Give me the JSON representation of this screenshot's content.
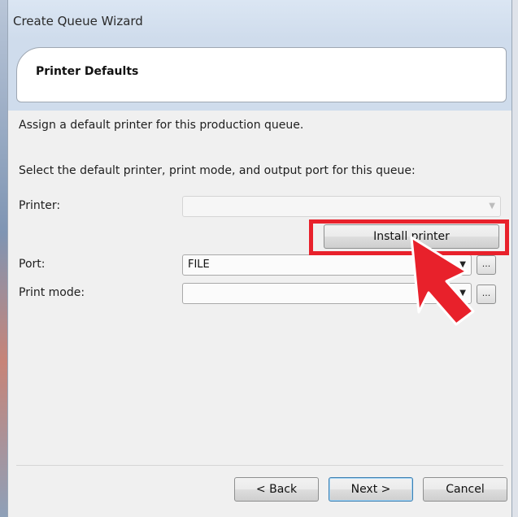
{
  "window": {
    "title": "Create Queue Wizard"
  },
  "header": {
    "title": "Printer Defaults"
  },
  "body": {
    "description": "Assign a default printer for this production queue.",
    "instruction": "Select the default printer, print mode, and output port for this queue:"
  },
  "fields": {
    "printer_label": "Printer:",
    "printer_value": "",
    "install_label": "Install printer",
    "port_label": "Port:",
    "port_value": "FILE",
    "print_mode_label": "Print mode:",
    "print_mode_value": "",
    "browse_label": "..."
  },
  "footer": {
    "back_label": "< Back",
    "next_label": "Next >",
    "cancel_label": "Cancel"
  },
  "icons": {
    "dropdown": "chevron-down-icon",
    "pointer": "red-arrow-pointer-icon"
  },
  "colors": {
    "highlight": "#e8212b",
    "header_band": "#cfdcec",
    "dialog_bg": "#f0f0f0"
  }
}
